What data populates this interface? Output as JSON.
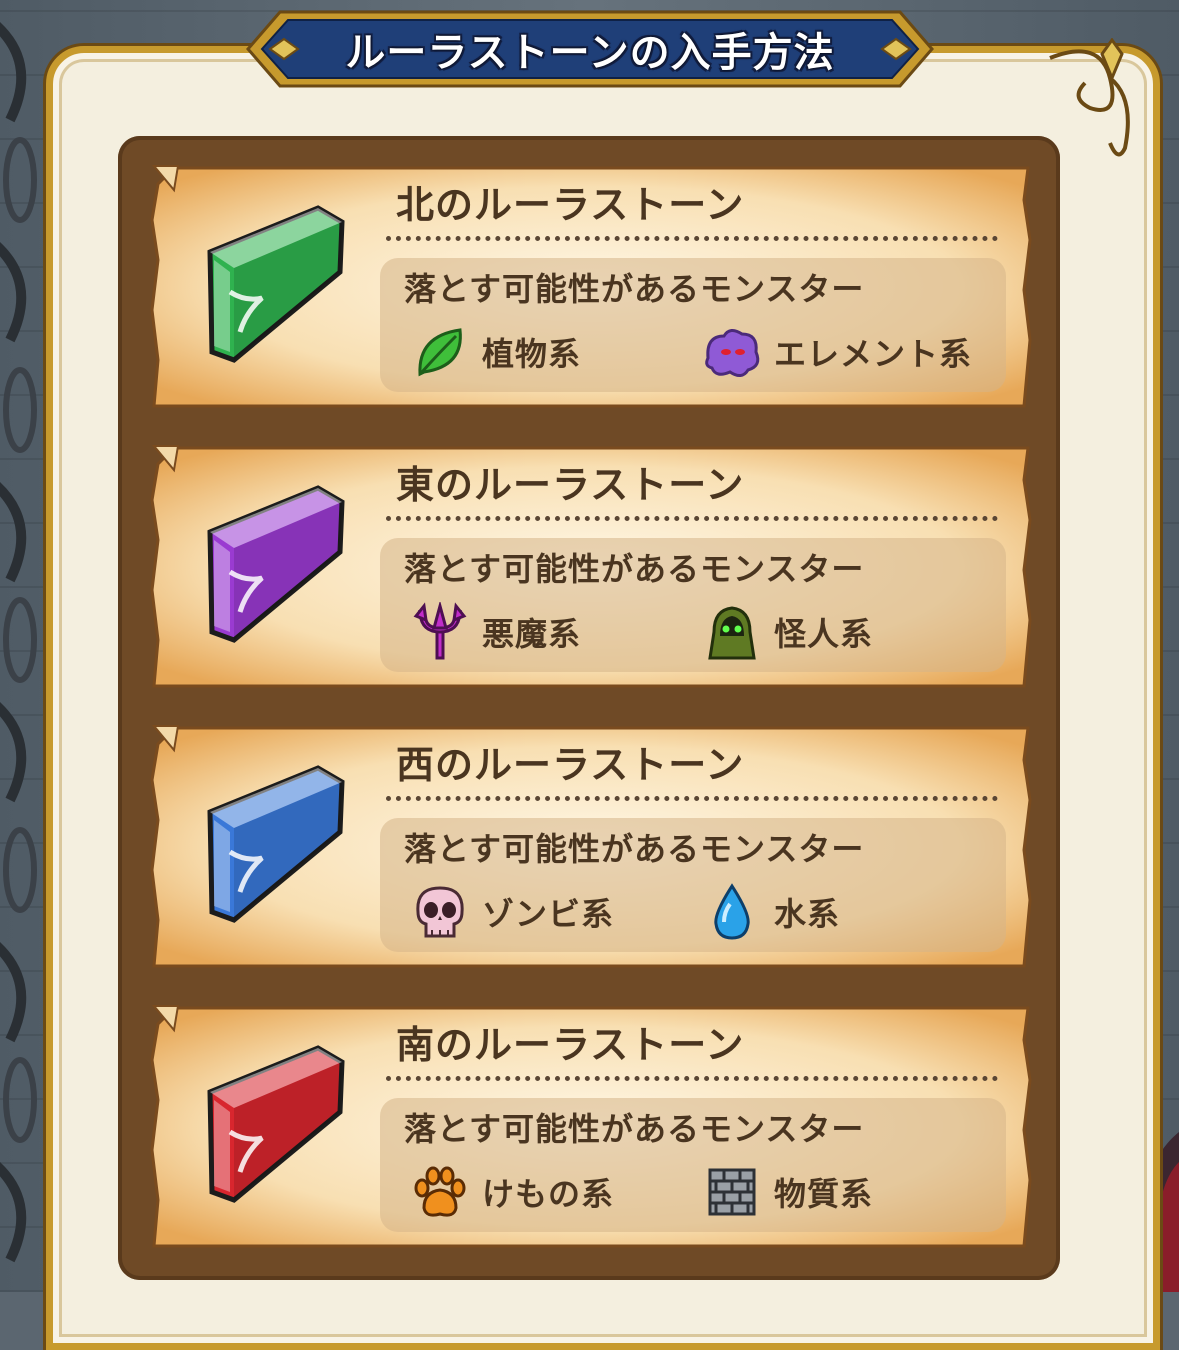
{
  "title": "ルーラストーンの入手方法",
  "cards": [
    {
      "name": "北のルーラストーン",
      "gem_color": "#2fb24f",
      "drop_label": "落とす可能性があるモンスター",
      "monsters": [
        {
          "label": "植物系",
          "icon": "leaf-icon"
        },
        {
          "label": "エレメント系",
          "icon": "element-ghost-icon"
        }
      ]
    },
    {
      "name": "東のルーラストーン",
      "gem_color": "#9a3bd1",
      "drop_label": "落とす可能性があるモンスター",
      "monsters": [
        {
          "label": "悪魔系",
          "icon": "trident-icon"
        },
        {
          "label": "怪人系",
          "icon": "hooded-figure-icon"
        }
      ]
    },
    {
      "name": "西のルーラストーン",
      "gem_color": "#3a78d8",
      "drop_label": "落とす可能性があるモンスター",
      "monsters": [
        {
          "label": "ゾンビ系",
          "icon": "skull-icon"
        },
        {
          "label": "水系",
          "icon": "water-drop-icon"
        }
      ]
    },
    {
      "name": "南のルーラストーン",
      "gem_color": "#d8262e",
      "drop_label": "落とす可能性があるモンスター",
      "monsters": [
        {
          "label": "けもの系",
          "icon": "paw-icon"
        },
        {
          "label": "物質系",
          "icon": "brick-icon"
        }
      ]
    }
  ]
}
